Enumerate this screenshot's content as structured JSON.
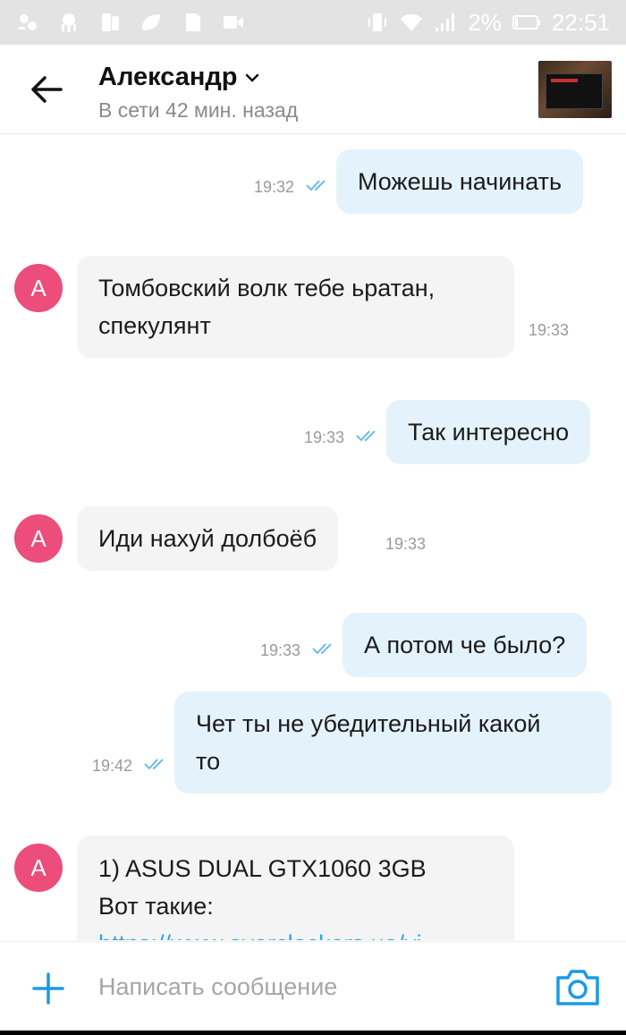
{
  "status_bar": {
    "battery": "2%",
    "time": "22:51"
  },
  "header": {
    "contact_name": "Александр",
    "status": "В сети 42 мин. назад"
  },
  "messages": [
    {
      "dir": "out",
      "text": "Можешь начинать",
      "time": "19:32"
    },
    {
      "dir": "in",
      "avatar": "А",
      "text_lines": [
        "Томбовский волк тебе ьратан,",
        "спекулянт"
      ],
      "time": "19:33"
    },
    {
      "dir": "out",
      "text": "Так интересно",
      "time": "19:33"
    },
    {
      "dir": "in",
      "avatar": "А",
      "text": "Иди нахуй долбоёб",
      "time": "19:33"
    },
    {
      "dir": "out",
      "text": "А потом че было?",
      "time": "19:33"
    },
    {
      "dir": "out",
      "text_lines": [
        "Чет ты не убедительный какой",
        "то"
      ],
      "time": "19:42"
    },
    {
      "dir": "in",
      "avatar": "А",
      "text_lines": [
        "1) ASUS DUAL GTX1060 3GB",
        "Вот такие:",
        "https://www.overclockers.ua/vi"
      ]
    }
  ],
  "composer": {
    "placeholder": "Написать сообщение"
  },
  "colors": {
    "outgoing_bubble": "#e4f2fb",
    "incoming_bubble": "#f4f4f4",
    "avatar": "#ec4d7b",
    "accent": "#1a9be6"
  },
  "icons": [
    "back-arrow-icon",
    "chevron-down-icon",
    "plus-icon",
    "camera-icon",
    "read-ticks-icon"
  ]
}
